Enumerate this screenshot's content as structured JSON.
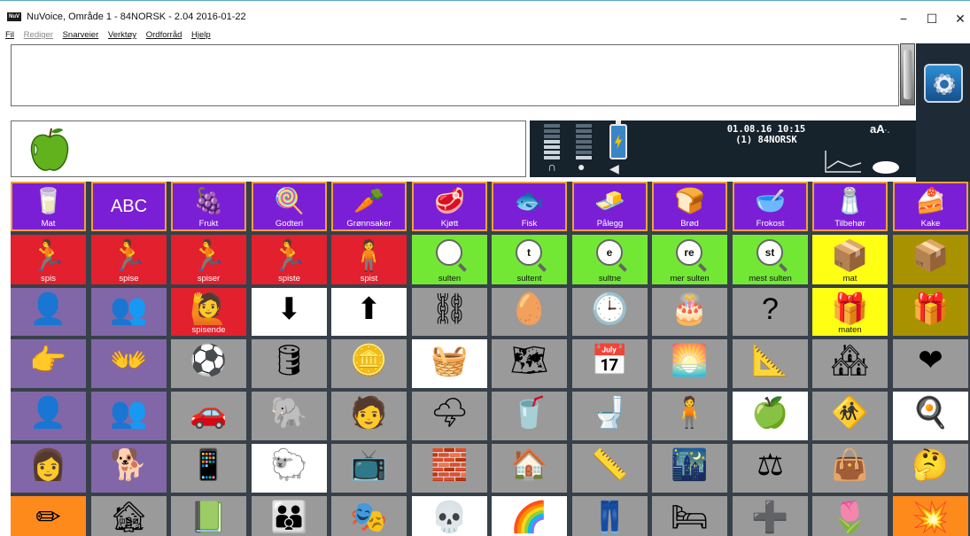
{
  "window": {
    "title": "NuVoice, Område 1 - 84NORSK - 2.04 2016-01-22",
    "logo_text": "NuV",
    "minimize": "−",
    "maximize": "☐",
    "close": "✕"
  },
  "menu": [
    "Fil",
    "Rediger",
    "Snarveier",
    "Verktøy",
    "Ordforråd",
    "Hjelp"
  ],
  "message_text": "",
  "status": {
    "datetime": "01.08.16 10:15",
    "vocabulary": "(1) 84NORSK",
    "font_icon_label": "aA",
    "font_icon_small": "·."
  },
  "categories": [
    {
      "label": "Mat",
      "icon": "glass-icon",
      "glyph": "🥛"
    },
    {
      "label": "",
      "icon": "abc-icon",
      "glyph": "ABC"
    },
    {
      "label": "Frukt",
      "icon": "fruit-basket-icon",
      "glyph": "🍇"
    },
    {
      "label": "Godteri",
      "icon": "candy-icon",
      "glyph": "🍭"
    },
    {
      "label": "Grønnsaker",
      "icon": "vegetables-icon",
      "glyph": "🥕"
    },
    {
      "label": "Kjøtt",
      "icon": "meat-icon",
      "glyph": "🥩"
    },
    {
      "label": "Fisk",
      "icon": "fish-icon",
      "glyph": "🐟"
    },
    {
      "label": "Pålegg",
      "icon": "spread-icon",
      "glyph": "🧈"
    },
    {
      "label": "Brød",
      "icon": "bread-icon",
      "glyph": "🍞"
    },
    {
      "label": "Frokost",
      "icon": "cereal-icon",
      "glyph": "🥣"
    },
    {
      "label": "Tilbehør",
      "icon": "condiments-icon",
      "glyph": "🧂"
    },
    {
      "label": "Kake",
      "icon": "cake-icon",
      "glyph": "🍰"
    }
  ],
  "rows": [
    [
      {
        "label": "spis",
        "color": "red",
        "icon": "eat-person-icon",
        "glyph": "🏃"
      },
      {
        "label": "spise",
        "color": "red",
        "icon": "eat-person-icon",
        "glyph": "🏃"
      },
      {
        "label": "spiser",
        "color": "red",
        "icon": "eat-person-icon",
        "glyph": "🏃"
      },
      {
        "label": "spiste",
        "color": "red",
        "icon": "eat-person-icon",
        "glyph": "🏃"
      },
      {
        "label": "spist",
        "color": "red",
        "icon": "eat-person-icon",
        "glyph": "🧍"
      },
      {
        "label": "sulten",
        "color": "green",
        "icon": "magnifier-icon",
        "letter": ""
      },
      {
        "label": "sultent",
        "color": "green",
        "icon": "magnifier-icon",
        "letter": "t"
      },
      {
        "label": "sultne",
        "color": "green",
        "icon": "magnifier-icon",
        "letter": "e"
      },
      {
        "label": "mer sulten",
        "color": "green",
        "icon": "magnifier-icon",
        "letter": "re"
      },
      {
        "label": "mest sulten",
        "color": "green",
        "icon": "magnifier-icon",
        "letter": "st"
      },
      {
        "label": "mat",
        "color": "yellow",
        "icon": "box-icon",
        "glyph": "📦"
      },
      {
        "label": "",
        "color": "olive",
        "icon": "boxes-icon",
        "glyph": "📦"
      }
    ],
    [
      {
        "label": "",
        "color": "lilac",
        "icon": "person-icon",
        "glyph": "👤"
      },
      {
        "label": "",
        "color": "lilac",
        "icon": "people-icon",
        "glyph": "👥"
      },
      {
        "label": "spisende",
        "color": "red",
        "icon": "eating-person-icon",
        "glyph": "🙋"
      },
      {
        "label": "",
        "color": "white",
        "icon": "box-down-icon",
        "glyph": "⬇"
      },
      {
        "label": "",
        "color": "white",
        "icon": "box-up-icon",
        "glyph": "⬆"
      },
      {
        "label": "",
        "color": "grey",
        "icon": "chain-icon",
        "glyph": "⛓"
      },
      {
        "label": "",
        "color": "grey",
        "icon": "broken-egg-icon",
        "glyph": "🥚"
      },
      {
        "label": "",
        "color": "grey",
        "icon": "clock-icon",
        "glyph": "🕒"
      },
      {
        "label": "",
        "color": "grey",
        "icon": "cake-slice-icon",
        "glyph": "🎂"
      },
      {
        "label": "",
        "color": "grey",
        "icon": "question-icon",
        "glyph": "?"
      },
      {
        "label": "maten",
        "color": "yellow",
        "icon": "gift-icon",
        "glyph": "🎁"
      },
      {
        "label": "",
        "color": "olive",
        "icon": "gifts-icon",
        "glyph": "🎁"
      }
    ],
    [
      {
        "label": "",
        "color": "lilac",
        "icon": "pointing-hand-icon",
        "glyph": "👉"
      },
      {
        "label": "",
        "color": "lilac",
        "icon": "pointing-hands-icon",
        "glyph": "👐"
      },
      {
        "label": "",
        "color": "grey",
        "icon": "soccer-ball-icon",
        "glyph": "⚽"
      },
      {
        "label": "",
        "color": "grey",
        "icon": "oil-can-icon",
        "glyph": "🛢"
      },
      {
        "label": "",
        "color": "grey",
        "icon": "coin-icon",
        "glyph": "🪙"
      },
      {
        "label": "",
        "color": "white",
        "icon": "picnic-icon",
        "glyph": "🧺"
      },
      {
        "label": "",
        "color": "grey",
        "icon": "map-icon",
        "glyph": "🗺"
      },
      {
        "label": "",
        "color": "grey",
        "icon": "calendar-icon",
        "glyph": "📅"
      },
      {
        "label": "",
        "color": "grey",
        "icon": "sunrise-icon",
        "glyph": "🌅"
      },
      {
        "label": "",
        "color": "grey",
        "icon": "ruler-triangle-icon",
        "glyph": "📐"
      },
      {
        "label": "",
        "color": "grey",
        "icon": "houses-icon",
        "glyph": "🏘"
      },
      {
        "label": "",
        "color": "grey",
        "icon": "heart-icon",
        "glyph": "❤"
      }
    ],
    [
      {
        "label": "",
        "color": "lilac",
        "icon": "person-icon",
        "glyph": "👤"
      },
      {
        "label": "",
        "color": "lilac",
        "icon": "crowd-icon",
        "glyph": "👥"
      },
      {
        "label": "",
        "color": "grey",
        "icon": "car-icon",
        "glyph": "🚗"
      },
      {
        "label": "",
        "color": "grey",
        "icon": "elephant-icon",
        "glyph": "🐘"
      },
      {
        "label": "",
        "color": "grey",
        "icon": "teacher-icon",
        "glyph": "🧑"
      },
      {
        "label": "",
        "color": "grey",
        "icon": "lightning-icon",
        "glyph": "🌩"
      },
      {
        "label": "",
        "color": "grey",
        "icon": "drink-icon",
        "glyph": "🥤"
      },
      {
        "label": "",
        "color": "grey",
        "icon": "bathroom-icon",
        "glyph": "🚽"
      },
      {
        "label": "",
        "color": "grey",
        "icon": "body-icon",
        "glyph": "🧍"
      },
      {
        "label": "",
        "color": "white",
        "icon": "apple-icon",
        "glyph": "🍏"
      },
      {
        "label": "",
        "color": "grey",
        "icon": "children-icon",
        "glyph": "🚸"
      },
      {
        "label": "",
        "color": "white",
        "icon": "frying-pan-icon",
        "glyph": "🍳"
      }
    ],
    [
      {
        "label": "",
        "color": "lilac",
        "icon": "woman-icon",
        "glyph": "👩"
      },
      {
        "label": "",
        "color": "lilac",
        "icon": "dog-icon",
        "glyph": "🐕"
      },
      {
        "label": "",
        "color": "grey",
        "icon": "phone-icon",
        "glyph": "📱"
      },
      {
        "label": "",
        "color": "white",
        "icon": "sheep-icon",
        "glyph": "🐑"
      },
      {
        "label": "",
        "color": "grey",
        "icon": "tv-icon",
        "glyph": "📺"
      },
      {
        "label": "",
        "color": "grey",
        "icon": "brick-icon",
        "glyph": "🧱"
      },
      {
        "label": "",
        "color": "grey",
        "icon": "house-icon",
        "glyph": "🏠"
      },
      {
        "label": "",
        "color": "grey",
        "icon": "ruler-icon",
        "glyph": "📏"
      },
      {
        "label": "",
        "color": "grey",
        "icon": "night-picture-icon",
        "glyph": "🌃"
      },
      {
        "label": "",
        "color": "grey",
        "icon": "scales-icon",
        "glyph": "⚖"
      },
      {
        "label": "",
        "color": "grey",
        "icon": "handbag-icon",
        "glyph": "👜"
      },
      {
        "label": "",
        "color": "grey",
        "icon": "thinking-icon",
        "glyph": "🤔"
      }
    ],
    [
      {
        "label": "",
        "color": "orange",
        "icon": "pencil-icon",
        "glyph": "✏"
      },
      {
        "label": "",
        "color": "grey",
        "icon": "doghouse-icon",
        "glyph": "🏚"
      },
      {
        "label": "",
        "color": "grey",
        "icon": "book-icon",
        "glyph": "📗"
      },
      {
        "label": "",
        "color": "grey",
        "icon": "family-icon",
        "glyph": "👪"
      },
      {
        "label": "",
        "color": "grey",
        "icon": "theater-masks-icon",
        "glyph": "🎭"
      },
      {
        "label": "",
        "color": "white",
        "icon": "skull-icon",
        "glyph": "💀"
      },
      {
        "label": "",
        "color": "white",
        "icon": "rainbow-icon",
        "glyph": "🌈"
      },
      {
        "label": "",
        "color": "grey",
        "icon": "trousers-icon",
        "glyph": "👖"
      },
      {
        "label": "",
        "color": "grey",
        "icon": "bed-icon",
        "glyph": "🛏"
      },
      {
        "label": "",
        "color": "grey",
        "icon": "first-aid-icon",
        "glyph": "➕"
      },
      {
        "label": "",
        "color": "grey",
        "icon": "flower-icon",
        "glyph": "🌷"
      },
      {
        "label": "",
        "color": "orange",
        "icon": "broken-icon",
        "glyph": "💥"
      }
    ]
  ]
}
